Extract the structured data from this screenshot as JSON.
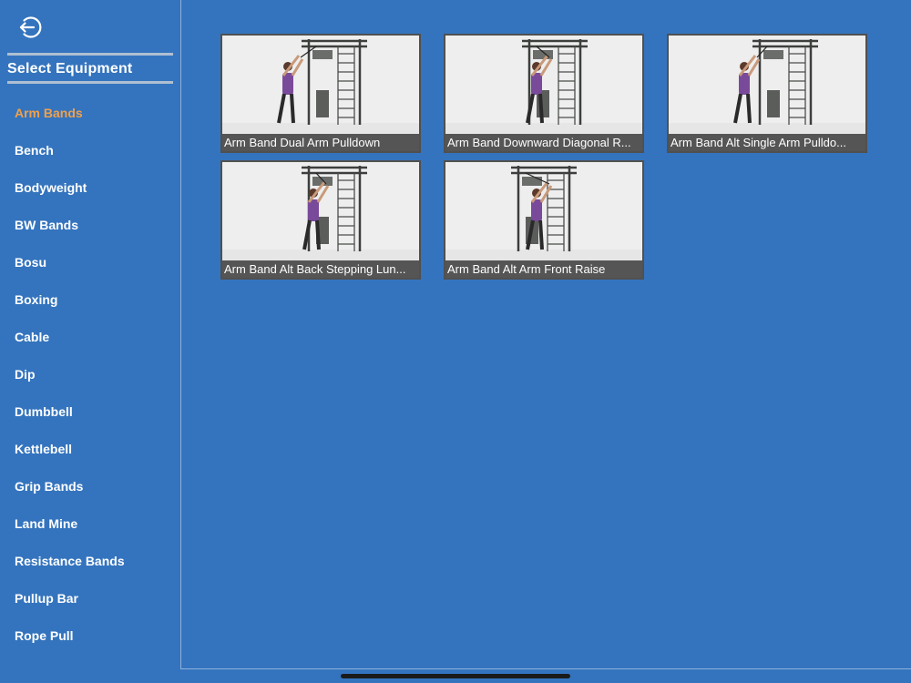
{
  "sidebar": {
    "back_icon": "back-arrow-circle-icon",
    "title": "Select Equipment",
    "items": [
      {
        "label": "Arm Bands",
        "active": true
      },
      {
        "label": "Bench"
      },
      {
        "label": "Bodyweight"
      },
      {
        "label": "BW Bands"
      },
      {
        "label": "Bosu"
      },
      {
        "label": "Boxing"
      },
      {
        "label": "Cable"
      },
      {
        "label": "Dip"
      },
      {
        "label": "Dumbbell"
      },
      {
        "label": "Kettlebell"
      },
      {
        "label": "Grip Bands"
      },
      {
        "label": "Land Mine"
      },
      {
        "label": "Resistance Bands"
      },
      {
        "label": "Pullup Bar"
      },
      {
        "label": "Rope Pull"
      }
    ]
  },
  "exercises": [
    {
      "caption": "Arm Band Dual Arm Pulldown"
    },
    {
      "caption": "Arm Band Downward Diagonal R..."
    },
    {
      "caption": "Arm Band Alt Single Arm Pulldo..."
    },
    {
      "caption": "Arm Band Alt Back Stepping Lun..."
    },
    {
      "caption": "Arm Band Alt Arm Front Raise"
    }
  ],
  "colors": {
    "background": "#3474be",
    "active_item": "#f0a04b",
    "caption_bar": "#555555",
    "tile_border": "#505050"
  }
}
